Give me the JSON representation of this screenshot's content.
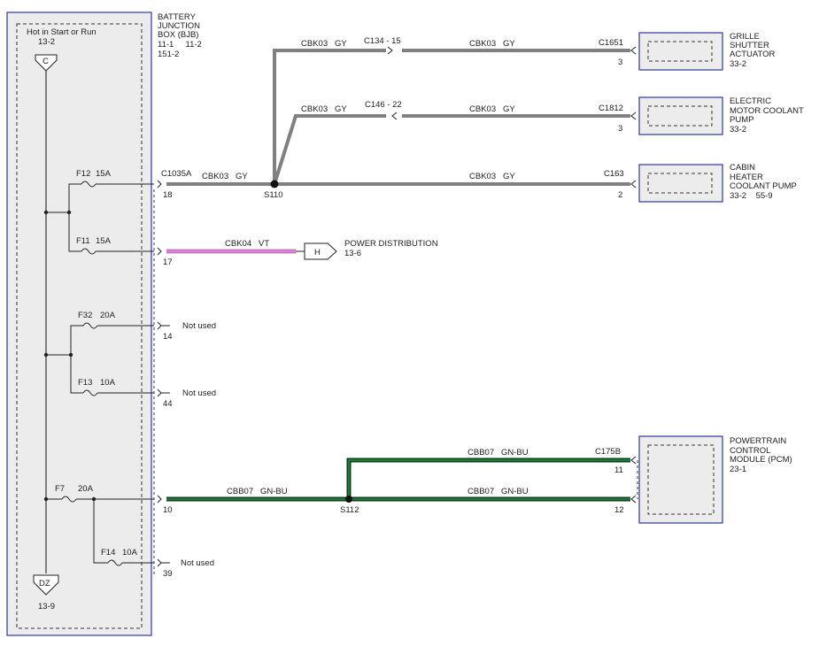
{
  "left_panel": {
    "top_label": "Hot in Start or Run",
    "top_ref": "13-2",
    "top_connector": "C",
    "bottom_connector": "DZ",
    "bottom_ref": "13-9"
  },
  "bjb": {
    "title_l1": "BATTERY",
    "title_l2": "JUNCTION",
    "title_l3": "BOX (BJB)",
    "refs_l1": "11-1     11-2",
    "refs_l2": "151-2"
  },
  "fuses": [
    {
      "name": "F12",
      "rating": "15A"
    },
    {
      "name": "F11",
      "rating": "15A"
    },
    {
      "name": "F32",
      "rating": "20A"
    },
    {
      "name": "F13",
      "rating": "10A"
    },
    {
      "name": "F7",
      "rating": "20A"
    },
    {
      "name": "F14",
      "rating": "10A"
    }
  ],
  "pins": {
    "p18": "18",
    "p17": "17",
    "p14": "14",
    "p44": "44",
    "p10": "10",
    "p39": "39"
  },
  "connectors": {
    "c1035a": "C1035A",
    "c134": "C134 - 15",
    "c146": "C146 - 22",
    "c1651": "C1651",
    "c1812": "C1812",
    "c163": "C163",
    "c175b": "C175B"
  },
  "splices": {
    "s110": "S110",
    "s112": "S112"
  },
  "wires": {
    "gy": "CBK03   GY",
    "vt": "CBK04   VT",
    "gnbu": "CBB07   GN-BU"
  },
  "not_used": "Not used",
  "power_dist": {
    "connector": "H",
    "label": "POWER DISTRIBUTION",
    "ref": "13-6"
  },
  "components": {
    "grille": {
      "l1": "GRILLE",
      "l2": "SHUTTER",
      "l3": "ACTUATOR",
      "ref": "33-2",
      "pin": "3"
    },
    "ecp": {
      "l1": "ELECTRIC",
      "l2": "MOTOR COOLANT",
      "l3": "PUMP",
      "ref": "33-2",
      "pin": "3"
    },
    "chp": {
      "l1": "CABIN",
      "l2": "HEATER",
      "l3": "COOLANT PUMP",
      "ref": "33-2    55-9",
      "pin": "2"
    },
    "pcm": {
      "l1": "POWERTRAIN",
      "l2": "CONTROL",
      "l3": "MODULE (PCM)",
      "ref": "23-1",
      "pin_a": "11",
      "pin_b": "12"
    }
  }
}
